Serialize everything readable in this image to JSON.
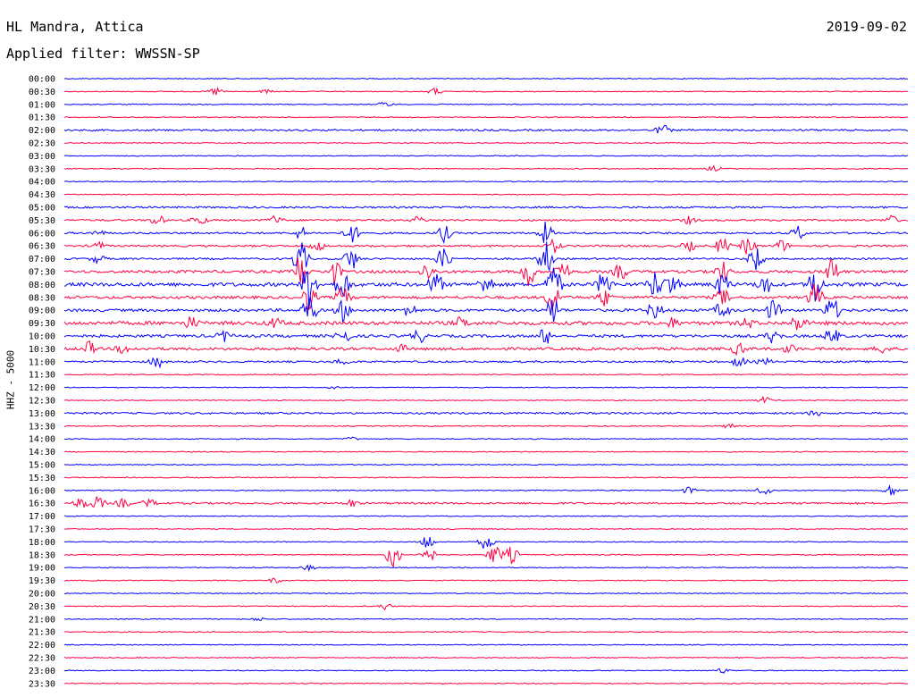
{
  "header": {
    "station": "HL Mandra, Attica",
    "date": "2019-09-02",
    "filter": "Applied filter: WWSSN-SP"
  },
  "chart_data": {
    "type": "line",
    "title": "HL Mandra, Attica",
    "ylabel": "HHZ - 5000",
    "colors": {
      "even": "#0000ff",
      "odd": "#ff0040"
    },
    "grid": false,
    "traces": [
      {
        "label": "00:00",
        "amplitude": 1,
        "bursts": []
      },
      {
        "label": "00:30",
        "amplitude": 1,
        "bursts": [
          [
            0.18,
            5
          ],
          [
            0.44,
            4
          ],
          [
            0.24,
            2
          ]
        ]
      },
      {
        "label": "01:00",
        "amplitude": 1,
        "bursts": [
          [
            0.38,
            3
          ]
        ]
      },
      {
        "label": "01:30",
        "amplitude": 1,
        "bursts": []
      },
      {
        "label": "02:00",
        "amplitude": 2,
        "bursts": [
          [
            0.71,
            6
          ]
        ]
      },
      {
        "label": "02:30",
        "amplitude": 1,
        "bursts": []
      },
      {
        "label": "03:00",
        "amplitude": 1,
        "bursts": []
      },
      {
        "label": "03:30",
        "amplitude": 1,
        "bursts": [
          [
            0.77,
            3
          ]
        ]
      },
      {
        "label": "04:00",
        "amplitude": 1,
        "bursts": []
      },
      {
        "label": "04:30",
        "amplitude": 1,
        "bursts": []
      },
      {
        "label": "05:00",
        "amplitude": 2,
        "bursts": []
      },
      {
        "label": "05:30",
        "amplitude": 2,
        "bursts": [
          [
            0.11,
            6
          ],
          [
            0.16,
            6
          ],
          [
            0.25,
            5
          ],
          [
            0.42,
            4
          ],
          [
            0.74,
            4
          ],
          [
            0.98,
            5
          ]
        ]
      },
      {
        "label": "06:00",
        "amplitude": 2,
        "bursts": [
          [
            0.28,
            8
          ],
          [
            0.34,
            12
          ],
          [
            0.45,
            10
          ],
          [
            0.57,
            12
          ],
          [
            0.87,
            8
          ],
          [
            0.04,
            3
          ]
        ]
      },
      {
        "label": "06:30",
        "amplitude": 2,
        "bursts": [
          [
            0.04,
            5
          ],
          [
            0.3,
            6
          ],
          [
            0.58,
            8
          ],
          [
            0.74,
            6
          ],
          [
            0.78,
            10
          ],
          [
            0.81,
            10
          ],
          [
            0.85,
            7
          ]
        ]
      },
      {
        "label": "07:00",
        "amplitude": 2,
        "bursts": [
          [
            0.04,
            5
          ],
          [
            0.28,
            22
          ],
          [
            0.34,
            14
          ],
          [
            0.45,
            14
          ],
          [
            0.57,
            22
          ],
          [
            0.82,
            14
          ]
        ]
      },
      {
        "label": "07:30",
        "amplitude": 3,
        "bursts": [
          [
            0.28,
            22
          ],
          [
            0.32,
            14
          ],
          [
            0.43,
            10
          ],
          [
            0.55,
            18
          ],
          [
            0.59,
            14
          ],
          [
            0.66,
            10
          ],
          [
            0.78,
            12
          ],
          [
            0.91,
            16
          ]
        ]
      },
      {
        "label": "08:00",
        "amplitude": 4,
        "bursts": [
          [
            0.29,
            28
          ],
          [
            0.33,
            18
          ],
          [
            0.44,
            14
          ],
          [
            0.5,
            12
          ],
          [
            0.58,
            24
          ],
          [
            0.64,
            16
          ],
          [
            0.7,
            16
          ],
          [
            0.72,
            14
          ],
          [
            0.78,
            14
          ],
          [
            0.83,
            12
          ],
          [
            0.89,
            22
          ]
        ]
      },
      {
        "label": "08:30",
        "amplitude": 3,
        "bursts": [
          [
            0.29,
            16
          ],
          [
            0.33,
            12
          ],
          [
            0.58,
            18
          ],
          [
            0.64,
            10
          ],
          [
            0.78,
            10
          ],
          [
            0.89,
            16
          ]
        ]
      },
      {
        "label": "09:00",
        "amplitude": 3,
        "bursts": [
          [
            0.29,
            18
          ],
          [
            0.33,
            12
          ],
          [
            0.41,
            8
          ],
          [
            0.58,
            16
          ],
          [
            0.7,
            10
          ],
          [
            0.78,
            10
          ],
          [
            0.84,
            12
          ],
          [
            0.91,
            16
          ]
        ]
      },
      {
        "label": "09:30",
        "amplitude": 4,
        "bursts": [
          [
            0.15,
            7
          ],
          [
            0.25,
            6
          ],
          [
            0.47,
            6
          ],
          [
            0.72,
            5
          ],
          [
            0.81,
            6
          ],
          [
            0.87,
            10
          ]
        ]
      },
      {
        "label": "10:00",
        "amplitude": 3,
        "bursts": [
          [
            0.19,
            6
          ],
          [
            0.33,
            10
          ],
          [
            0.42,
            8
          ],
          [
            0.57,
            10
          ],
          [
            0.84,
            8
          ],
          [
            0.91,
            10
          ]
        ]
      },
      {
        "label": "10:30",
        "amplitude": 3,
        "bursts": [
          [
            0.03,
            8
          ],
          [
            0.07,
            5
          ],
          [
            0.4,
            4
          ],
          [
            0.8,
            7
          ],
          [
            0.86,
            5
          ],
          [
            0.97,
            5
          ]
        ]
      },
      {
        "label": "11:00",
        "amplitude": 2,
        "bursts": [
          [
            0.11,
            7
          ],
          [
            0.33,
            4
          ],
          [
            0.8,
            6
          ],
          [
            0.83,
            4
          ]
        ]
      },
      {
        "label": "11:30",
        "amplitude": 1,
        "bursts": []
      },
      {
        "label": "12:00",
        "amplitude": 1,
        "bursts": [
          [
            0.32,
            2
          ]
        ]
      },
      {
        "label": "12:30",
        "amplitude": 1,
        "bursts": [
          [
            0.83,
            4
          ]
        ]
      },
      {
        "label": "13:00",
        "amplitude": 2,
        "bursts": [
          [
            0.89,
            3
          ]
        ]
      },
      {
        "label": "13:30",
        "amplitude": 1,
        "bursts": [
          [
            0.79,
            3
          ]
        ]
      },
      {
        "label": "14:00",
        "amplitude": 1,
        "bursts": [
          [
            0.34,
            2
          ]
        ]
      },
      {
        "label": "14:30",
        "amplitude": 1,
        "bursts": []
      },
      {
        "label": "15:00",
        "amplitude": 1,
        "bursts": []
      },
      {
        "label": "15:30",
        "amplitude": 1,
        "bursts": []
      },
      {
        "label": "16:00",
        "amplitude": 1,
        "bursts": [
          [
            0.74,
            4
          ],
          [
            0.83,
            8
          ],
          [
            0.98,
            6
          ]
        ]
      },
      {
        "label": "16:30",
        "amplitude": 2,
        "bursts": [
          [
            0.02,
            7
          ],
          [
            0.04,
            8
          ],
          [
            0.07,
            5
          ],
          [
            0.1,
            5
          ],
          [
            0.34,
            4
          ]
        ]
      },
      {
        "label": "17:00",
        "amplitude": 1,
        "bursts": []
      },
      {
        "label": "17:30",
        "amplitude": 1,
        "bursts": []
      },
      {
        "label": "18:00",
        "amplitude": 1,
        "bursts": [
          [
            0.43,
            10
          ],
          [
            0.5,
            10
          ]
        ]
      },
      {
        "label": "18:30",
        "amplitude": 1,
        "bursts": [
          [
            0.39,
            16
          ],
          [
            0.43,
            14
          ],
          [
            0.51,
            12
          ],
          [
            0.53,
            10
          ]
        ]
      },
      {
        "label": "19:00",
        "amplitude": 1,
        "bursts": [
          [
            0.29,
            3
          ]
        ]
      },
      {
        "label": "19:30",
        "amplitude": 1,
        "bursts": [
          [
            0.25,
            3
          ]
        ]
      },
      {
        "label": "20:00",
        "amplitude": 1,
        "bursts": []
      },
      {
        "label": "20:30",
        "amplitude": 1,
        "bursts": [
          [
            0.38,
            4
          ]
        ]
      },
      {
        "label": "21:00",
        "amplitude": 1,
        "bursts": [
          [
            0.23,
            2
          ]
        ]
      },
      {
        "label": "21:30",
        "amplitude": 1,
        "bursts": []
      },
      {
        "label": "22:00",
        "amplitude": 1,
        "bursts": []
      },
      {
        "label": "22:30",
        "amplitude": 1,
        "bursts": []
      },
      {
        "label": "23:00",
        "amplitude": 1,
        "bursts": [
          [
            0.78,
            3
          ]
        ]
      },
      {
        "label": "23:30",
        "amplitude": 1,
        "bursts": []
      }
    ]
  }
}
